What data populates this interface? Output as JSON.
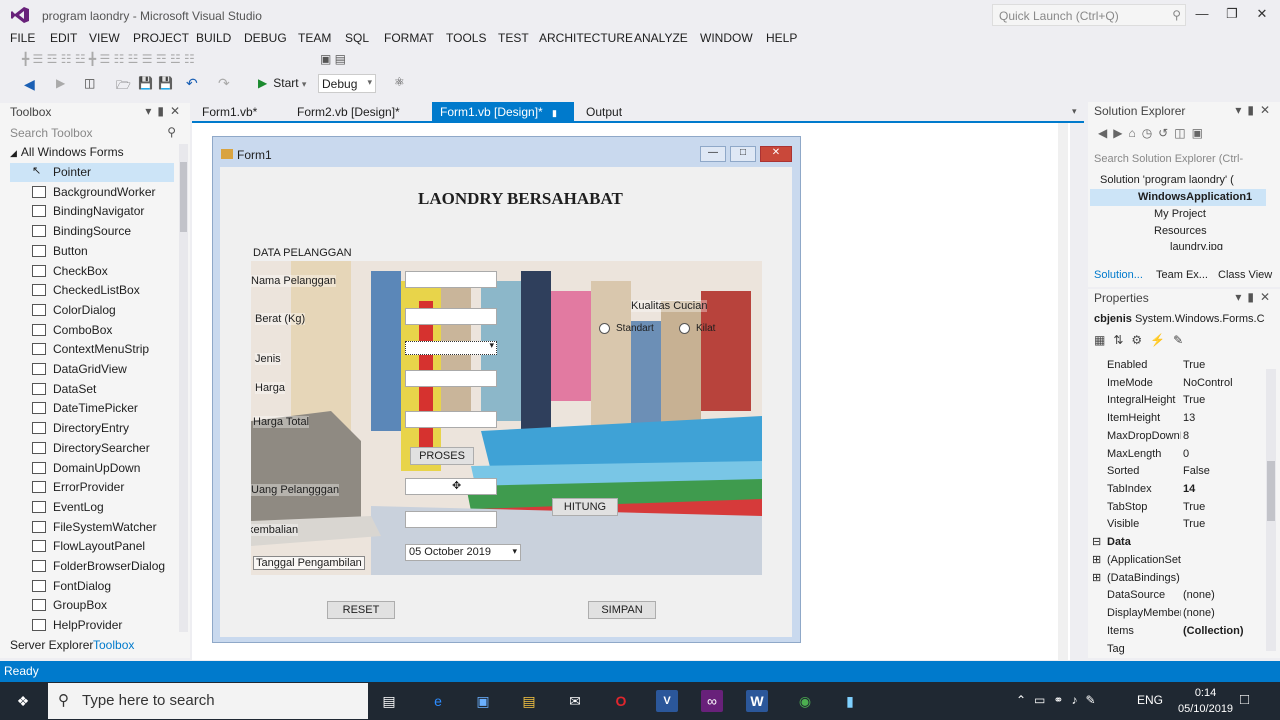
{
  "window": {
    "title": "program laondry - Microsoft Visual Studio",
    "quick_launch": "Quick Launch (Ctrl+Q)"
  },
  "menu": [
    "FILE",
    "EDIT",
    "VIEW",
    "PROJECT",
    "BUILD",
    "DEBUG",
    "TEAM",
    "SQL",
    "FORMAT",
    "TOOLS",
    "TEST",
    "ARCHITECTURE",
    "ANALYZE",
    "WINDOW",
    "HELP"
  ],
  "toolbar": {
    "start_label": "Start",
    "config": "Debug"
  },
  "toolbox": {
    "title": "Toolbox",
    "search": "Search Toolbox",
    "category": "All Windows Forms",
    "items": [
      "Pointer",
      "BackgroundWorker",
      "BindingNavigator",
      "BindingSource",
      "Button",
      "CheckBox",
      "CheckedListBox",
      "ColorDialog",
      "ComboBox",
      "ContextMenuStrip",
      "DataGridView",
      "DataSet",
      "DateTimePicker",
      "DirectoryEntry",
      "DirectorySearcher",
      "DomainUpDown",
      "ErrorProvider",
      "EventLog",
      "FileSystemWatcher",
      "FlowLayoutPanel",
      "FolderBrowserDialog",
      "FontDialog",
      "GroupBox",
      "HelpProvider"
    ],
    "bottom_tabs": [
      "Server Explorer",
      "Toolbox"
    ]
  },
  "doc_tabs": [
    "Form1.vb*",
    "Form2.vb [Design]*",
    "Form1.vb [Design]*",
    "Output"
  ],
  "form": {
    "title": "Form1",
    "heading": "LAONDRY BERSAHABAT",
    "group_label": "DATA PELANGGAN",
    "labels": {
      "nama": "Nama Pelanggan",
      "berat": "Berat (Kg)",
      "jenis": "Jenis",
      "harga": "Harga",
      "harga_total": "Harga Total",
      "uang": "Uang Pelangggan",
      "kembalian": "kembalian",
      "tanggal": "Tanggal Pengambilan",
      "kualitas": "Kualitas Cucian"
    },
    "radios": {
      "standart": "Standart",
      "kilat": "Kilat"
    },
    "buttons": {
      "proses": "PROSES",
      "hitung": "HITUNG",
      "reset": "RESET",
      "simpan": "SIMPAN"
    },
    "date_value": "05   October   2019"
  },
  "solution_explorer": {
    "title": "Solution Explorer",
    "search": "Search Solution Explorer (Ctrl-",
    "tree": [
      "Solution 'program laondry' (",
      "WindowsApplication1",
      "My Project",
      "Resources",
      "laundry.jpg"
    ],
    "tabs": [
      "Solution...",
      "Team Ex...",
      "Class View"
    ]
  },
  "properties": {
    "title": "Properties",
    "object": "cbjenis",
    "object_type": "System.Windows.Forms.C",
    "rows": [
      {
        "k": "Enabled",
        "v": "True"
      },
      {
        "k": "ImeMode",
        "v": "NoControl"
      },
      {
        "k": "IntegralHeight",
        "v": "True"
      },
      {
        "k": "ItemHeight",
        "v": "13"
      },
      {
        "k": "MaxDropDownItems",
        "v": "8"
      },
      {
        "k": "MaxLength",
        "v": "0"
      },
      {
        "k": "Sorted",
        "v": "False"
      },
      {
        "k": "TabIndex",
        "v": "14"
      },
      {
        "k": "TabStop",
        "v": "True"
      },
      {
        "k": "Visible",
        "v": "True"
      }
    ],
    "section_data": "Data",
    "rows2": [
      {
        "k": "(ApplicationSettings)",
        "v": ""
      },
      {
        "k": "(DataBindings)",
        "v": ""
      },
      {
        "k": "DataSource",
        "v": "(none)"
      },
      {
        "k": "DisplayMember",
        "v": "(none)"
      },
      {
        "k": "Items",
        "v": "(Collection)"
      },
      {
        "k": "Tag",
        "v": ""
      }
    ]
  },
  "status": "Ready",
  "taskbar": {
    "search": "Type here to search",
    "lang": "ENG",
    "time": "0:14",
    "date": "05/10/2019"
  },
  "colors": {
    "accent": "#007acc",
    "taskbar": "#1f2832",
    "vs_purple": "#68217a"
  }
}
